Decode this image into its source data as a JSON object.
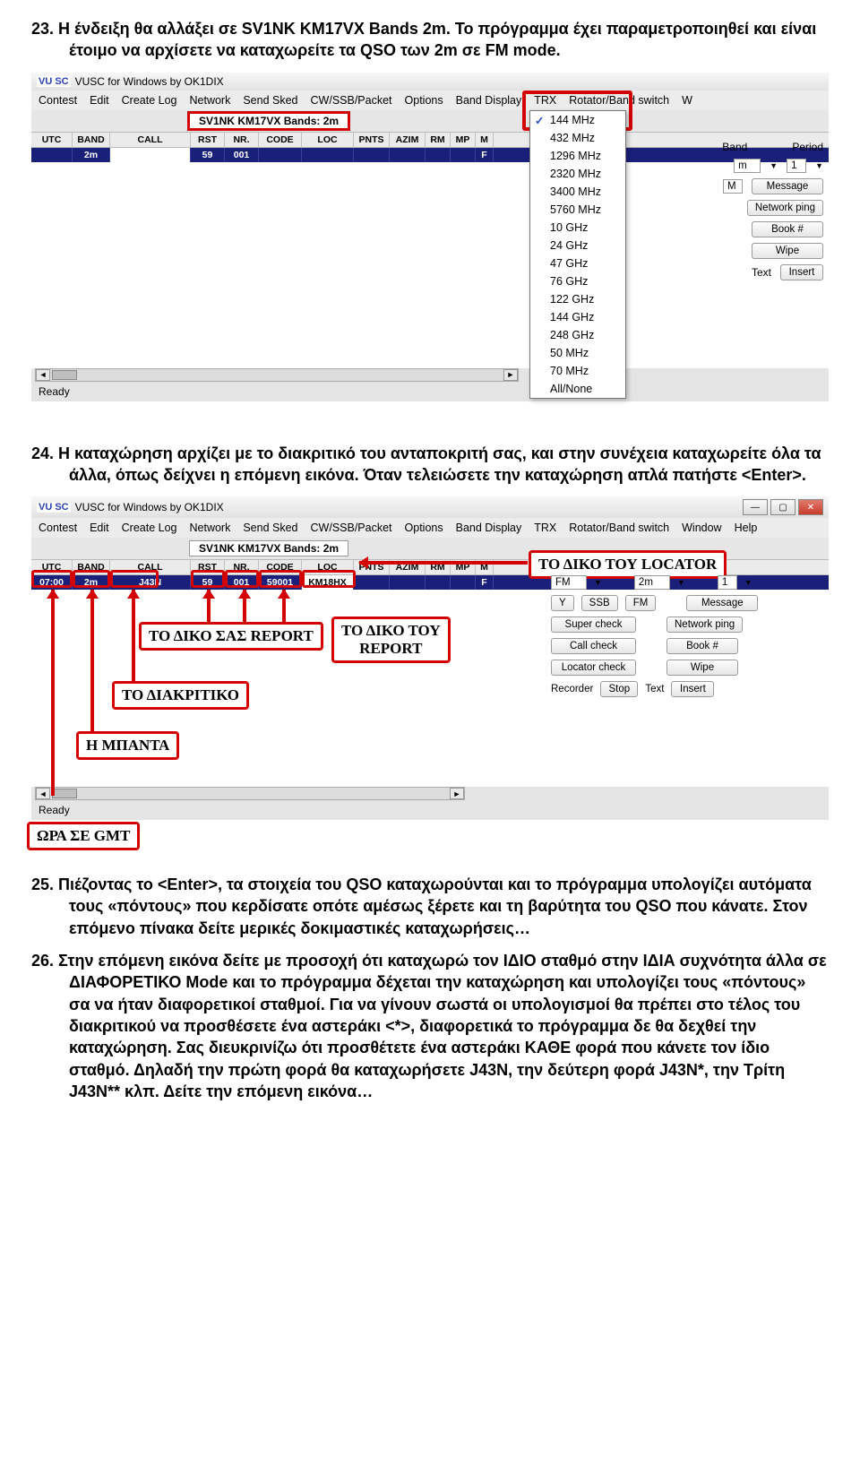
{
  "para23": "23. Η ένδειξη θα αλλάξει σε SV1NK KM17VX Bands 2m. Το πρόγραμμα έχει παραμετροποιηθεί και είναι έτοιμο να αρχίσετε να καταχωρείτε τα QSO των 2m σε FM mode.",
  "para24": "24. Η καταχώρηση αρχίζει με το διακριτικό του ανταποκριτή σας, και στην συνέχεια καταχωρείτε όλα τα άλλα, όπως δείχνει η επόμενη εικόνα. Όταν τελειώσετε την καταχώρηση απλά πατήστε <Enter>.",
  "para25": "25. Πιέζοντας το <Enter>, τα στοιχεία του QSO καταχωρούνται και το πρόγραμμα υπολογίζει αυτόματα τους «πόντους» που κερδίσατε οπότε αμέσως ξέρετε και τη βαρύτητα του QSO που κάνατε. Στον επόμενο πίνακα δείτε μερικές δοκιμαστικές καταχωρήσεις…",
  "para26": "26. Στην επόμενη εικόνα δείτε με προσοχή ότι καταχωρώ τον ΙΔΙΟ σταθμό στην ΙΔΙΑ συχνότητα άλλα σε ΔΙΑΦΟΡΕΤΙΚΟ Mode και το πρόγραμμα δέχεται την καταχώρηση και υπολογίζει τους «πόντους» σα να ήταν διαφορετικοί σταθμοί. Για να γίνουν σωστά οι υπολογισμοί θα πρέπει στο τέλος του διακριτικού να προσθέσετε ένα αστεράκι <*>, διαφορετικά το πρόγραμμα δε θα δεχθεί την καταχώρηση. Σας διευκρινίζω ότι προσθέτετε ένα αστεράκι ΚΑΘΕ φορά που κάνετε τον ίδιο σταθμό. Δηλαδή την πρώτη φορά θα καταχωρήσετε J43N, την δεύτερη φορά J43N*, την Τρίτη J43N** κλπ. Δείτε την επόμενη εικόνα…",
  "app": {
    "title": "VUSC for Windows by OK1DIX",
    "logo": "VU SC",
    "menus": [
      "Contest",
      "Edit",
      "Create Log",
      "Network",
      "Send Sked",
      "CW/SSB/Packet",
      "Options",
      "Band Display",
      "TRX",
      "Rotator/Band switch",
      "W"
    ],
    "menus2": [
      "Contest",
      "Edit",
      "Create Log",
      "Network",
      "Send Sked",
      "CW/SSB/Packet",
      "Options",
      "Band Display",
      "TRX",
      "Rotator/Band switch",
      "Window",
      "Help"
    ],
    "bands_badge": "SV1NK KM17VX Bands: 2m",
    "cols": [
      "UTC",
      "BAND",
      "CALL",
      "RST",
      "NR.",
      "CODE",
      "LOC",
      "PNTS",
      "AZIM",
      "RM",
      "MP",
      "M"
    ],
    "row1": {
      "utc": " ",
      "band": "2m",
      "call": " ",
      "rst": "59",
      "nr": "001",
      "code": " ",
      "loc": " ",
      "pnts": " ",
      "azim": " ",
      "rm": " ",
      "mp": " ",
      "m": "F"
    },
    "row2": {
      "utc": "07:00",
      "band": "2m",
      "call": "J43N",
      "rst": "59",
      "nr": "001",
      "code": "59001",
      "loc": "KM18HX",
      "pnts": " ",
      "azim": " ",
      "rm": " ",
      "mp": " ",
      "m": "F"
    },
    "status": "Ready",
    "dropdown": [
      "144 MHz",
      "432 MHz",
      "1296 MHz",
      "2320 MHz",
      "3400 MHz",
      "5760 MHz",
      "10 GHz",
      "24 GHz",
      "47 GHz",
      "76 GHz",
      "122 GHz",
      "144 GHz",
      "248 GHz",
      "50 MHz",
      "70 MHz",
      "All/None"
    ],
    "rp1": {
      "band_lbl": "Band",
      "period_lbl": "Period",
      "m_sel": "m",
      "one_sel": "1",
      "msg_sel": "M",
      "btn_message": "Message",
      "btn_netping": "Network ping",
      "btn_book": "Book #",
      "btn_wipe": "Wipe",
      "text_lbl": "Text",
      "btn_insert": "Insert"
    },
    "rp2": {
      "fm_sel": "FM",
      "band2m": "2m",
      "one": "1",
      "y": "Y",
      "ssb": "SSB",
      "fm": "FM",
      "superchk": "Super check",
      "callchk": "Call check",
      "locchk": "Locator check",
      "recorder": "Recorder",
      "stop": "Stop",
      "text": "Text",
      "insert": "Insert",
      "message": "Message",
      "netping": "Network ping",
      "book": "Book #",
      "wipe": "Wipe"
    }
  },
  "callouts": {
    "loc": "ΤΟ ΔΙΚΟ ΤΟΥ LOCATOR",
    "myrep": "ΤΟ ΔΙΚΟ ΣΑΣ REPORT",
    "hisrep1": "ΤΟ ΔΙΚΟ ΤΟΥ",
    "hisrep2": "REPORT",
    "callsign": "ΤΟ ΔΙΑΚΡΙΤΙΚΟ",
    "band": "Η ΜΠΑΝΤΑ",
    "time": "ΩΡΑ ΣΕ GMT"
  }
}
